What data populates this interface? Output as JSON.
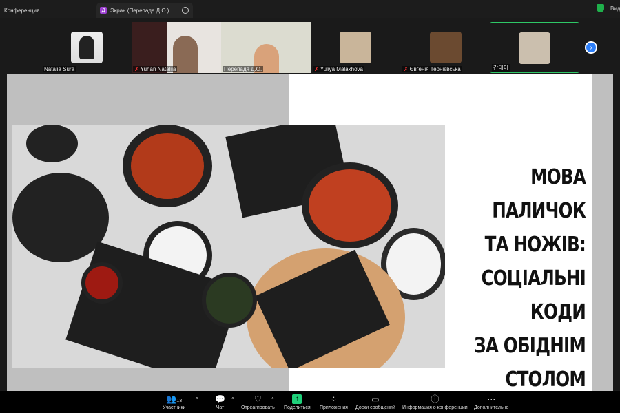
{
  "topbar": {
    "tab1": "Конференция",
    "tab2": "Экран (Перепада Д.О.)",
    "tab2_initial": "Д",
    "view": "Вид"
  },
  "participants": [
    {
      "name": "Natalia Sura",
      "muted": false
    },
    {
      "name": "Yuhan Nataliia",
      "muted": true
    },
    {
      "name": "Перепадя Д.О.",
      "muted": false
    },
    {
      "name": "Yuliya Malakhova",
      "muted": true
    },
    {
      "name": "Євгенія Тернієвська",
      "muted": true
    },
    {
      "name": "간태이",
      "muted": false,
      "active": true
    }
  ],
  "slide": {
    "title_lines": [
      "МОВА ПАЛИЧОК",
      "ТА НОЖІВ:",
      "СОЦІАЛЬНІ КОДИ",
      "ЗА ОБІДНІМ",
      "СТОЛОМ"
    ]
  },
  "toolbar": {
    "participants": "Участники",
    "participants_count": "13",
    "chat": "Чат",
    "react": "Отреагировать",
    "share": "Поделиться",
    "apps": "Приложения",
    "whiteboards": "Доски сообщений",
    "info": "Информация о конференции",
    "more": "Дополнительно"
  }
}
